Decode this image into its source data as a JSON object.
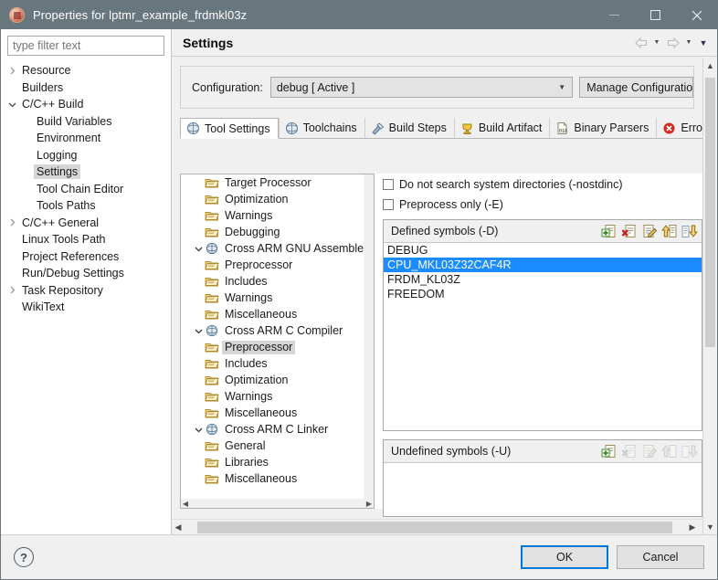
{
  "window": {
    "title": "Properties for lptmr_example_frdmkl03z",
    "icon": "app-icon",
    "controls": {
      "minimize": "minimize-button",
      "maximize": "maximize-button",
      "close": "close-button"
    },
    "titlebar_color": "#67777d"
  },
  "filter": {
    "placeholder": "type filter text",
    "value": ""
  },
  "nav_tree": {
    "items": [
      {
        "label": "Resource",
        "indent": 0,
        "twisty": "collapsed",
        "selected": false
      },
      {
        "label": "Builders",
        "indent": 0,
        "twisty": "none",
        "selected": false
      },
      {
        "label": "C/C++ Build",
        "indent": 0,
        "twisty": "expanded",
        "selected": false
      },
      {
        "label": "Build Variables",
        "indent": 1,
        "twisty": "none",
        "selected": false
      },
      {
        "label": "Environment",
        "indent": 1,
        "twisty": "none",
        "selected": false
      },
      {
        "label": "Logging",
        "indent": 1,
        "twisty": "none",
        "selected": false
      },
      {
        "label": "Settings",
        "indent": 1,
        "twisty": "none",
        "selected": true
      },
      {
        "label": "Tool Chain Editor",
        "indent": 1,
        "twisty": "none",
        "selected": false
      },
      {
        "label": "Tools Paths",
        "indent": 1,
        "twisty": "none",
        "selected": false
      },
      {
        "label": "C/C++ General",
        "indent": 0,
        "twisty": "collapsed",
        "selected": false
      },
      {
        "label": "Linux Tools Path",
        "indent": 0,
        "twisty": "none",
        "selected": false
      },
      {
        "label": "Project References",
        "indent": 0,
        "twisty": "none",
        "selected": false
      },
      {
        "label": "Run/Debug Settings",
        "indent": 0,
        "twisty": "none",
        "selected": false
      },
      {
        "label": "Task Repository",
        "indent": 0,
        "twisty": "collapsed",
        "selected": false
      },
      {
        "label": "WikiText",
        "indent": 0,
        "twisty": "none",
        "selected": false
      }
    ]
  },
  "settings": {
    "title": "Settings",
    "nav": {
      "back": "back-arrow-icon",
      "forward": "forward-arrow-icon",
      "menu": "view-menu-icon"
    },
    "configuration": {
      "label": "Configuration:",
      "value": "debug  [ Active ]",
      "manage_button": "Manage Configuratio"
    },
    "tabs": [
      {
        "label": "Tool Settings",
        "icon": "tool-settings-icon",
        "active": true
      },
      {
        "label": "Toolchains",
        "icon": "toolchains-icon",
        "active": false
      },
      {
        "label": "Build Steps",
        "icon": "build-steps-icon",
        "active": false
      },
      {
        "label": "Build Artifact",
        "icon": "build-artifact-icon",
        "active": false
      },
      {
        "label": "Binary Parsers",
        "icon": "binary-parsers-icon",
        "active": false
      },
      {
        "label": "Error Pa",
        "icon": "error-parsers-icon",
        "active": false
      }
    ]
  },
  "tool_tree": {
    "items": [
      {
        "label": "Target Processor",
        "indent": 1,
        "twisty": "none",
        "icon": "folder-icon",
        "selected": false
      },
      {
        "label": "Optimization",
        "indent": 1,
        "twisty": "none",
        "icon": "folder-icon",
        "selected": false
      },
      {
        "label": "Warnings",
        "indent": 1,
        "twisty": "none",
        "icon": "folder-icon",
        "selected": false
      },
      {
        "label": "Debugging",
        "indent": 1,
        "twisty": "none",
        "icon": "folder-icon",
        "selected": false
      },
      {
        "label": "Cross ARM GNU Assembler",
        "indent": 0,
        "twisty": "expanded",
        "icon": "tool-icon",
        "selected": false
      },
      {
        "label": "Preprocessor",
        "indent": 1,
        "twisty": "none",
        "icon": "folder-icon",
        "selected": false
      },
      {
        "label": "Includes",
        "indent": 1,
        "twisty": "none",
        "icon": "folder-icon",
        "selected": false
      },
      {
        "label": "Warnings",
        "indent": 1,
        "twisty": "none",
        "icon": "folder-icon",
        "selected": false
      },
      {
        "label": "Miscellaneous",
        "indent": 1,
        "twisty": "none",
        "icon": "folder-icon",
        "selected": false
      },
      {
        "label": "Cross ARM C Compiler",
        "indent": 0,
        "twisty": "expanded",
        "icon": "tool-icon",
        "selected": false
      },
      {
        "label": "Preprocessor",
        "indent": 1,
        "twisty": "none",
        "icon": "folder-icon",
        "selected": true
      },
      {
        "label": "Includes",
        "indent": 1,
        "twisty": "none",
        "icon": "folder-icon",
        "selected": false
      },
      {
        "label": "Optimization",
        "indent": 1,
        "twisty": "none",
        "icon": "folder-icon",
        "selected": false
      },
      {
        "label": "Warnings",
        "indent": 1,
        "twisty": "none",
        "icon": "folder-icon",
        "selected": false
      },
      {
        "label": "Miscellaneous",
        "indent": 1,
        "twisty": "none",
        "icon": "folder-icon",
        "selected": false
      },
      {
        "label": "Cross ARM C Linker",
        "indent": 0,
        "twisty": "expanded",
        "icon": "tool-icon",
        "selected": false
      },
      {
        "label": "General",
        "indent": 1,
        "twisty": "none",
        "icon": "folder-icon",
        "selected": false
      },
      {
        "label": "Libraries",
        "indent": 1,
        "twisty": "none",
        "icon": "folder-icon",
        "selected": false
      },
      {
        "label": "Miscellaneous",
        "indent": 1,
        "twisty": "none",
        "icon": "folder-icon",
        "selected": false
      }
    ]
  },
  "preprocessor_options": {
    "checkboxes": [
      {
        "label": "Do not search system directories (-nostdinc)",
        "checked": false
      },
      {
        "label": "Preprocess only (-E)",
        "checked": false
      }
    ],
    "defined_symbols": {
      "title": "Defined symbols (-D)",
      "tools": [
        "add-icon",
        "delete-icon",
        "edit-icon",
        "move-up-icon",
        "move-down-icon"
      ],
      "items": [
        {
          "value": "DEBUG",
          "selected": false
        },
        {
          "value": "CPU_MKL03Z32CAF4R",
          "selected": true
        },
        {
          "value": "FRDM_KL03Z",
          "selected": false
        },
        {
          "value": "FREEDOM",
          "selected": false
        }
      ]
    },
    "undefined_symbols": {
      "title": "Undefined symbols (-U)",
      "tools": [
        "add-icon",
        "delete-icon",
        "edit-icon",
        "move-up-icon",
        "move-down-icon"
      ],
      "items": []
    }
  },
  "footer": {
    "help": "?",
    "ok": "OK",
    "cancel": "Cancel"
  },
  "colors": {
    "selection_blue": "#1a8cff",
    "focus_blue": "#0078d7",
    "titlebar": "#67777d",
    "tree_selection_gray": "#d6d6d6"
  }
}
